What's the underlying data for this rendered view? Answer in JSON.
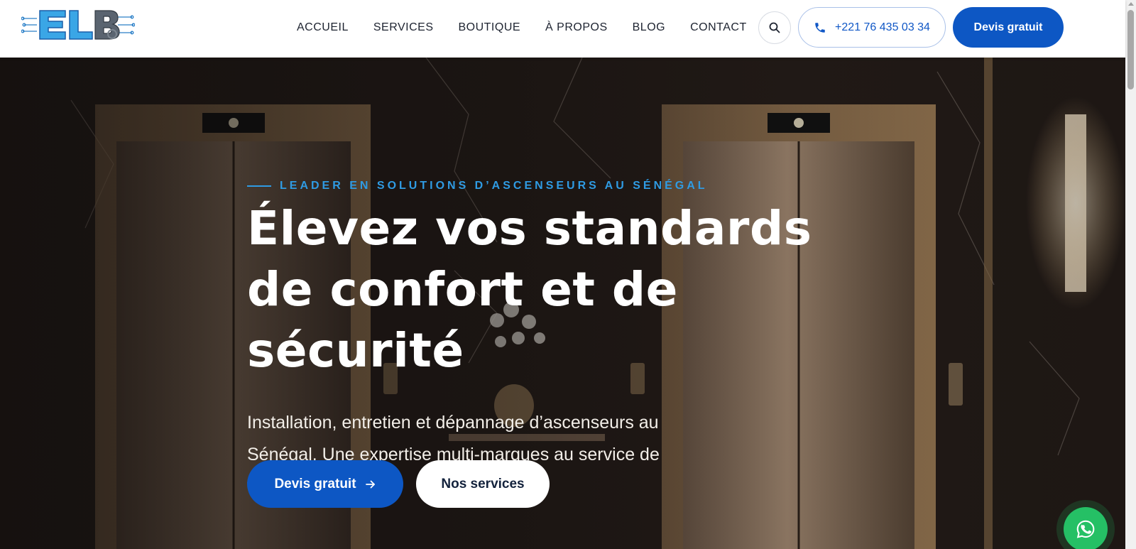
{
  "brand": {
    "logo_text": "ELB",
    "colors": {
      "primary": "#0d57c4",
      "accent": "#2f9be3",
      "whatsapp": "#25c065"
    }
  },
  "nav": {
    "items": [
      {
        "label": "ACCUEIL"
      },
      {
        "label": "SERVICES"
      },
      {
        "label": "BOUTIQUE"
      },
      {
        "label": "À PROPOS"
      },
      {
        "label": "BLOG"
      },
      {
        "label": "CONTACT"
      }
    ],
    "search_icon": "search-icon",
    "phone_label": "+221 76 435 03 34",
    "phone_icon": "phone-icon",
    "quote_label": "Devis gratuit"
  },
  "hero": {
    "eyebrow": "LEADER EN SOLUTIONS D’ASCENSEURS AU SÉNÉGAL",
    "headline": "Élevez vos standards de confort et de sécurité",
    "subtitle": "Installation, entretien et dépannage d’ascenseurs au Sénégal. Une expertise multi-marques au service de votre tranquillité.",
    "primary_cta": "Devis gratuit",
    "primary_cta_icon": "arrow-right-icon",
    "secondary_cta": "Nos services"
  },
  "floating": {
    "whatsapp_icon": "whatsapp-icon"
  }
}
